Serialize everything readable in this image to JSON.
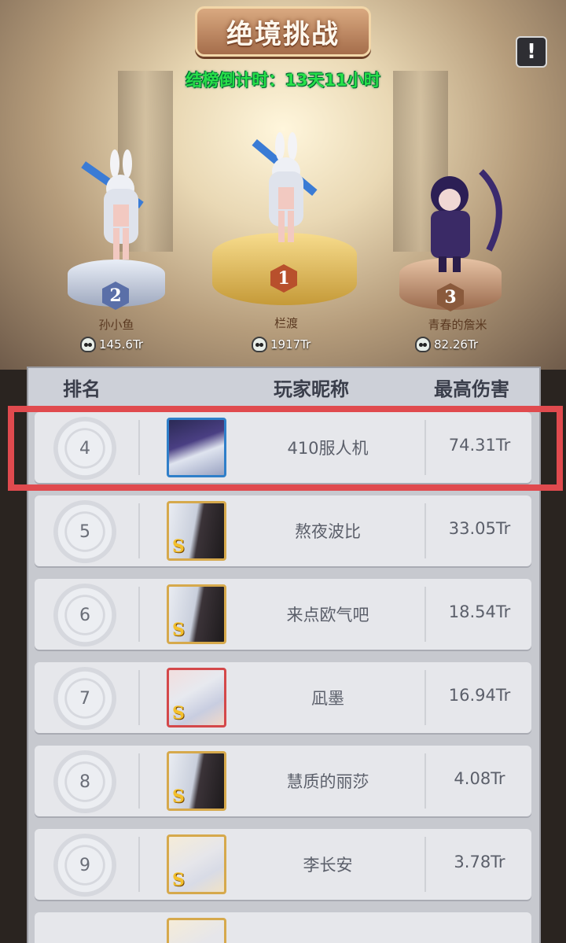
{
  "header": {
    "title": "绝境挑战",
    "countdown": "结榜倒计时：13天11小时",
    "info_icon": "exclamation-icon"
  },
  "top3": [
    {
      "rank": "2",
      "name": "孙小鱼",
      "score": "145.6Tr",
      "badge_color": "#5a6fa8"
    },
    {
      "rank": "1",
      "name": "栏渡",
      "score": "1917Tr",
      "badge_color": "#b8502c"
    },
    {
      "rank": "3",
      "name": "青春的詹米",
      "score": "82.26Tr",
      "badge_color": "#8a5a3c"
    }
  ],
  "table": {
    "headers": {
      "rank": "排名",
      "player": "玩家昵称",
      "damage": "最高伤害"
    },
    "rows": [
      {
        "rank": "4",
        "name": "410服人机",
        "damage": "74.31Tr",
        "frame": "blue",
        "s": ""
      },
      {
        "rank": "5",
        "name": "熬夜波比",
        "damage": "33.05Tr",
        "frame": "gold",
        "s": "S"
      },
      {
        "rank": "6",
        "name": "来点欧气吧",
        "damage": "18.54Tr",
        "frame": "gold",
        "s": "S"
      },
      {
        "rank": "7",
        "name": "凪墨",
        "damage": "16.94Tr",
        "frame": "red",
        "s": "S"
      },
      {
        "rank": "8",
        "name": "慧质的丽莎",
        "damage": "4.08Tr",
        "frame": "gold",
        "s": "S"
      },
      {
        "rank": "9",
        "name": "李长安",
        "damage": "3.78Tr",
        "frame": "gold",
        "s": "S"
      }
    ]
  },
  "colors": {
    "highlight": "#e04a4e",
    "countdown": "#28e04a"
  }
}
